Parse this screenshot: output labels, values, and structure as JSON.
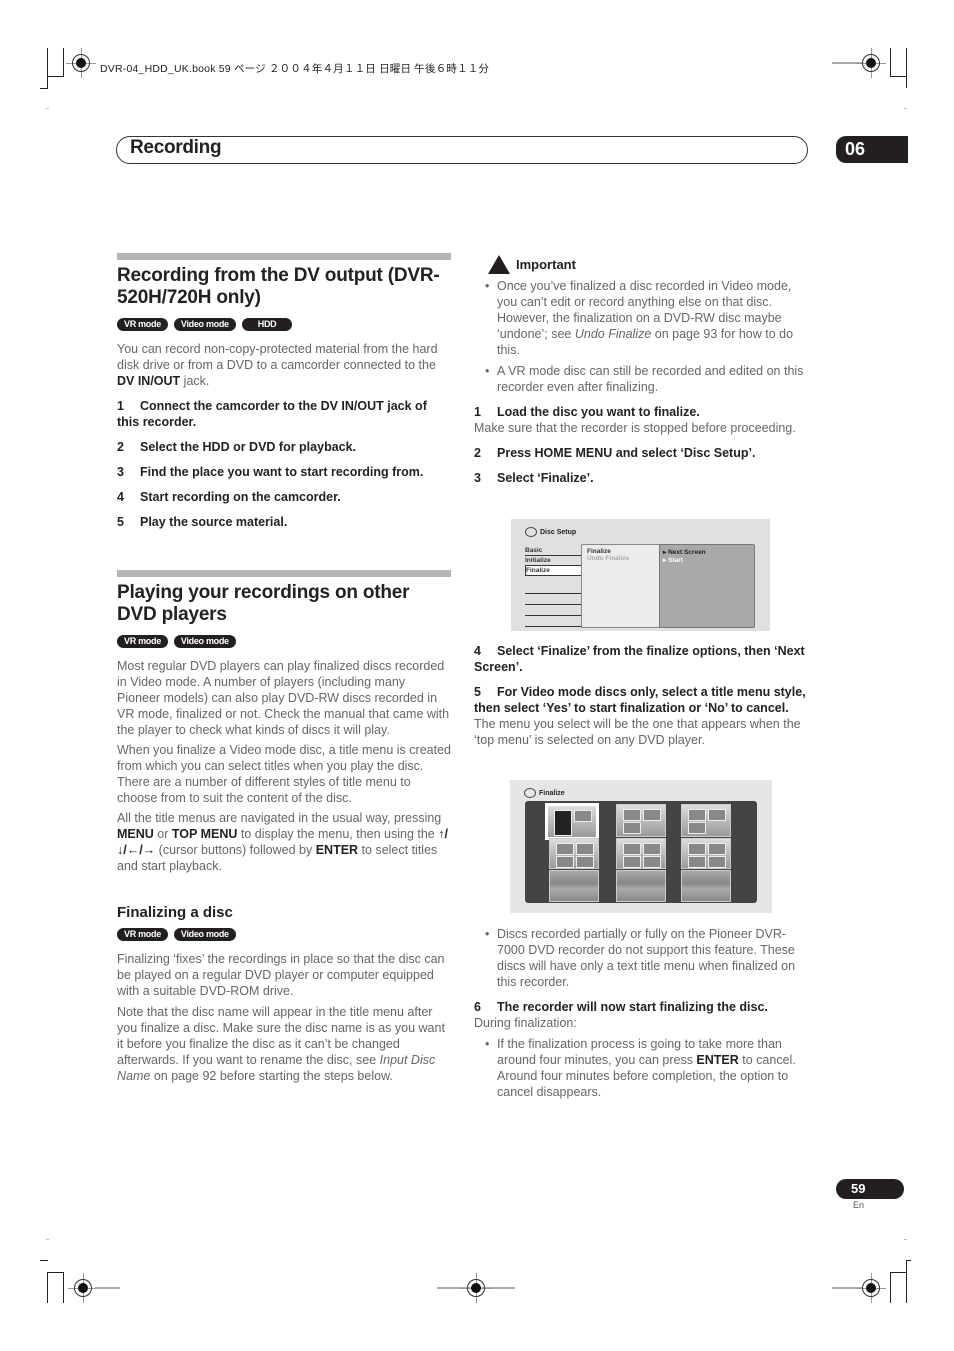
{
  "print_job_line": "DVR-04_HDD_UK.book  59 ページ  ２００４年４月１１日  日曜日  午後６時１１分",
  "header": {
    "section_title": "Recording",
    "chapter_number": "06"
  },
  "left_column": {
    "section1": {
      "title": "Recording from the DV output (DVR-520H/720H only)",
      "badges": [
        "VR mode",
        "Video mode",
        "HDD"
      ],
      "intro_pre": "You can record non-copy-protected material from the hard disk drive or from a DVD to a camcorder connected to the ",
      "intro_bold": "DV IN/OUT",
      "intro_post": " jack.",
      "steps": [
        {
          "num": "1",
          "text": "Connect the camcorder to the DV IN/OUT jack of this recorder."
        },
        {
          "num": "2",
          "text": "Select the HDD or DVD for playback."
        },
        {
          "num": "3",
          "text": "Find the place you want to start recording from."
        },
        {
          "num": "4",
          "text": "Start recording on the camcorder."
        },
        {
          "num": "5",
          "text": "Play the source material."
        }
      ]
    },
    "section2": {
      "title": "Playing your recordings on other DVD players",
      "badges": [
        "VR mode",
        "Video mode"
      ],
      "para1": "Most regular DVD players can play finalized discs recorded in Video mode. A number of players (including many Pioneer models) can also play DVD-RW discs recorded in VR mode, finalized or not. Check the manual that came with the player to check what kinds of discs it will play.",
      "para2": "When you finalize a Video mode disc, a title menu is created from which you can select titles when you play the disc. There are a number of different styles of title menu to choose from to suit the content of the disc.",
      "para3": {
        "t1": "All the title menus are navigated in the usual way, pressing ",
        "b1": "MENU",
        "t2": " or ",
        "b2": "TOP MENU",
        "t3": " to display the menu, then using the ",
        "arrows": "↑/↓/←/→",
        "t4": " (cursor buttons) followed by ",
        "b3": "ENTER",
        "t5": " to select titles and start playback."
      }
    },
    "subsection": {
      "title": "Finalizing a disc",
      "badges": [
        "VR mode",
        "Video mode"
      ],
      "para1": "Finalizing ‘fixes’ the recordings in place so that the disc can be played on a regular DVD player or computer equipped with a suitable DVD-ROM drive.",
      "para2_pre": "Note that the disc name will appear in the title menu after you finalize a disc. Make sure the disc name is as you want it before you finalize the disc as it can’t be changed afterwards. If you want to rename the disc, see ",
      "para2_italic": "Input Disc Name",
      "para2_post": " on page 92 before starting the steps below."
    }
  },
  "right_column": {
    "important": {
      "title": "Important",
      "bullets": [
        {
          "pre": "Once you’ve finalized a disc recorded in Video mode, you can’t edit or record anything else on that disc. However, the finalization on a DVD-RW disc maybe ‘undone’; see ",
          "italic": "Undo Finalize",
          "post": " on page 93 for how to do this."
        },
        {
          "pre": "A VR mode disc can still be recorded and edited on this recorder even after finalizing.",
          "italic": "",
          "post": ""
        }
      ]
    },
    "step1": {
      "num": "1",
      "text": "Load the disc you want to finalize.",
      "note": "Make sure that the recorder is stopped before proceeding."
    },
    "step2": {
      "num": "2",
      "text": "Press HOME MENU and select ‘Disc Setup’."
    },
    "step3": {
      "num": "3",
      "text": "Select ‘Finalize’."
    },
    "disc_setup_screen": {
      "title": "Disc Setup",
      "left_menu": [
        "Basic",
        "Initialize",
        "Finalize"
      ],
      "selected_left": "Finalize",
      "middle_options": [
        "Finalize",
        "Undo Finalize"
      ],
      "right_options": [
        "Next Screen",
        "Start"
      ]
    },
    "step4": {
      "num": "4",
      "text": "Select ‘Finalize’ from the finalize options, then ‘Next Screen’."
    },
    "step5": {
      "num": "5",
      "text": "For Video mode discs only, select a title menu style, then select ‘Yes’ to start finalization or ‘No’ to cancel.",
      "note": "The menu you select will be the one that appears when the ‘top menu’ is selected on any DVD player."
    },
    "finalize_screen": {
      "title": "Finalize",
      "thumbnail_count": 9,
      "selected_index": 0
    },
    "bullet_after_screen": "Discs recorded partially or fully on the Pioneer DVR-7000 DVD recorder do not support this feature. These discs will have only a text title menu when finalized on this recorder.",
    "step6": {
      "num": "6",
      "text": "The recorder will now start finalizing the disc.",
      "note": "During finalization:"
    },
    "final_bullet": {
      "pre": "If the finalization process is going to take more than around four minutes, you can press ",
      "bold": "ENTER",
      "post": " to cancel. Around four minutes before completion, the option to cancel disappears."
    }
  },
  "footer": {
    "page_number": "59",
    "language": "En"
  }
}
